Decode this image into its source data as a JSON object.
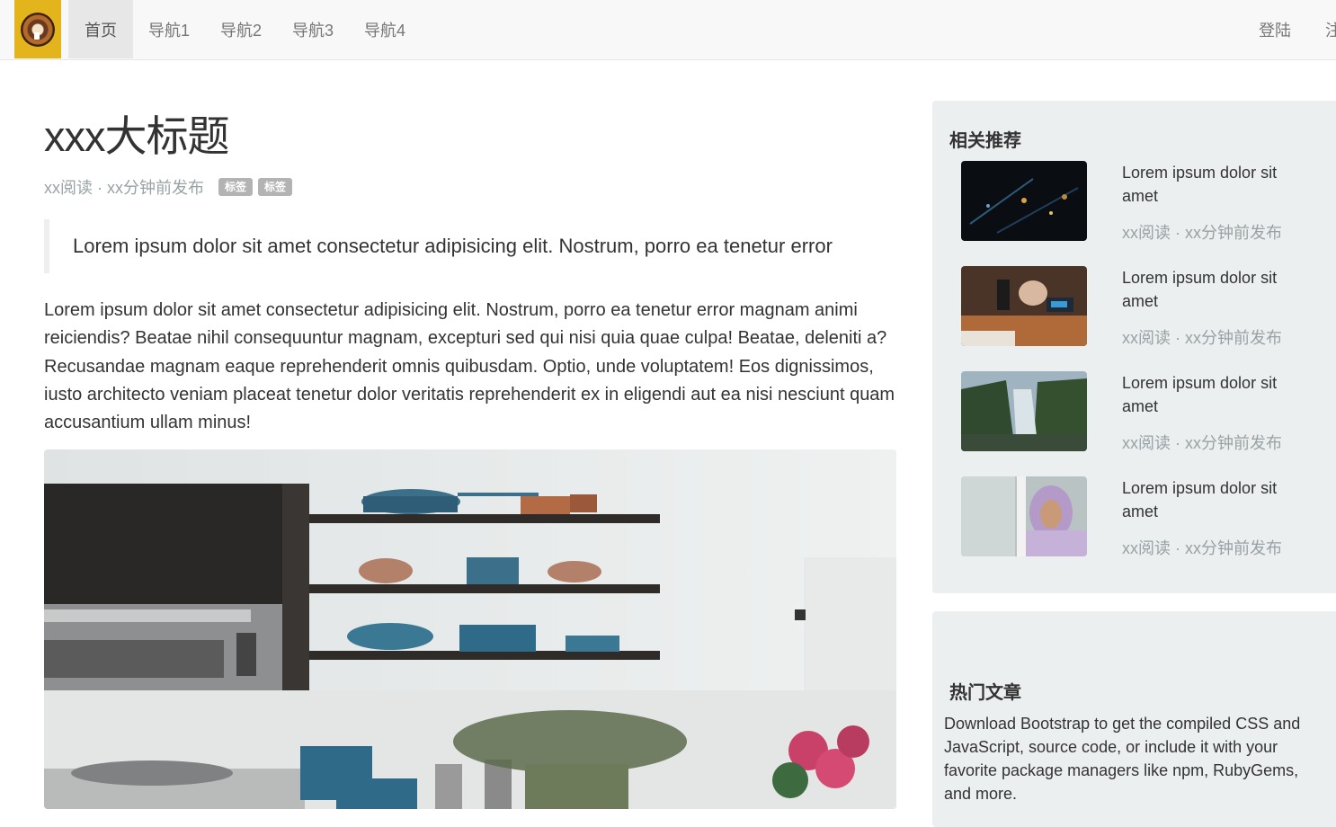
{
  "navbar": {
    "brand": "logo",
    "items": [
      {
        "label": "首页",
        "active": true
      },
      {
        "label": "导航1"
      },
      {
        "label": "导航2"
      },
      {
        "label": "导航3"
      },
      {
        "label": "导航4"
      }
    ],
    "right": [
      {
        "label": "登陆"
      },
      {
        "label": "注"
      }
    ]
  },
  "article": {
    "title": "xxx大标题",
    "meta": "xx阅读 · xx分钟前发布",
    "tags": [
      "标签",
      "标签"
    ],
    "quote": "Lorem ipsum dolor sit amet consectetur adipisicing elit. Nostrum, porro ea tenetur error",
    "body": "Lorem ipsum dolor sit amet consectetur adipisicing elit. Nostrum, porro ea tenetur error magnam animi reiciendis? Beatae nihil consequuntur magnam, excepturi sed qui nisi quia quae culpa! Beatae, deleniti a? Recusandae magnam eaque reprehenderit omnis quibusdam. Optio, unde voluptatem! Eos dignissimos, iusto architecto veniam placeat tenetur dolor veritatis reprehenderit ex in eligendi aut ea nisi nesciunt quam accusantium ullam minus!"
  },
  "sidebar": {
    "recommend": {
      "title": "相关推荐",
      "items": [
        {
          "title": "Lorem ipsum dolor sit amet",
          "meta": "xx阅读 · xx分钟前发布"
        },
        {
          "title": "Lorem ipsum dolor sit amet",
          "meta": "xx阅读 · xx分钟前发布"
        },
        {
          "title": "Lorem ipsum dolor sit amet",
          "meta": "xx阅读 · xx分钟前发布"
        },
        {
          "title": "Lorem ipsum dolor sit amet",
          "meta": "xx阅读 · xx分钟前发布"
        }
      ]
    },
    "hot": {
      "title": "热门文章",
      "text": "Download Bootstrap to get the compiled CSS and JavaScript, source code, or include it with your favorite package managers like npm, RubyGems, and more."
    }
  },
  "colors": {
    "navbar_bg": "#f8f8f8",
    "active_nav_bg": "#e7e7e7",
    "muted_text": "#98a2a4",
    "tag_bg": "#b3b3b3",
    "panel_bg": "#eceff0",
    "brand_bg": "#e4b41c"
  }
}
